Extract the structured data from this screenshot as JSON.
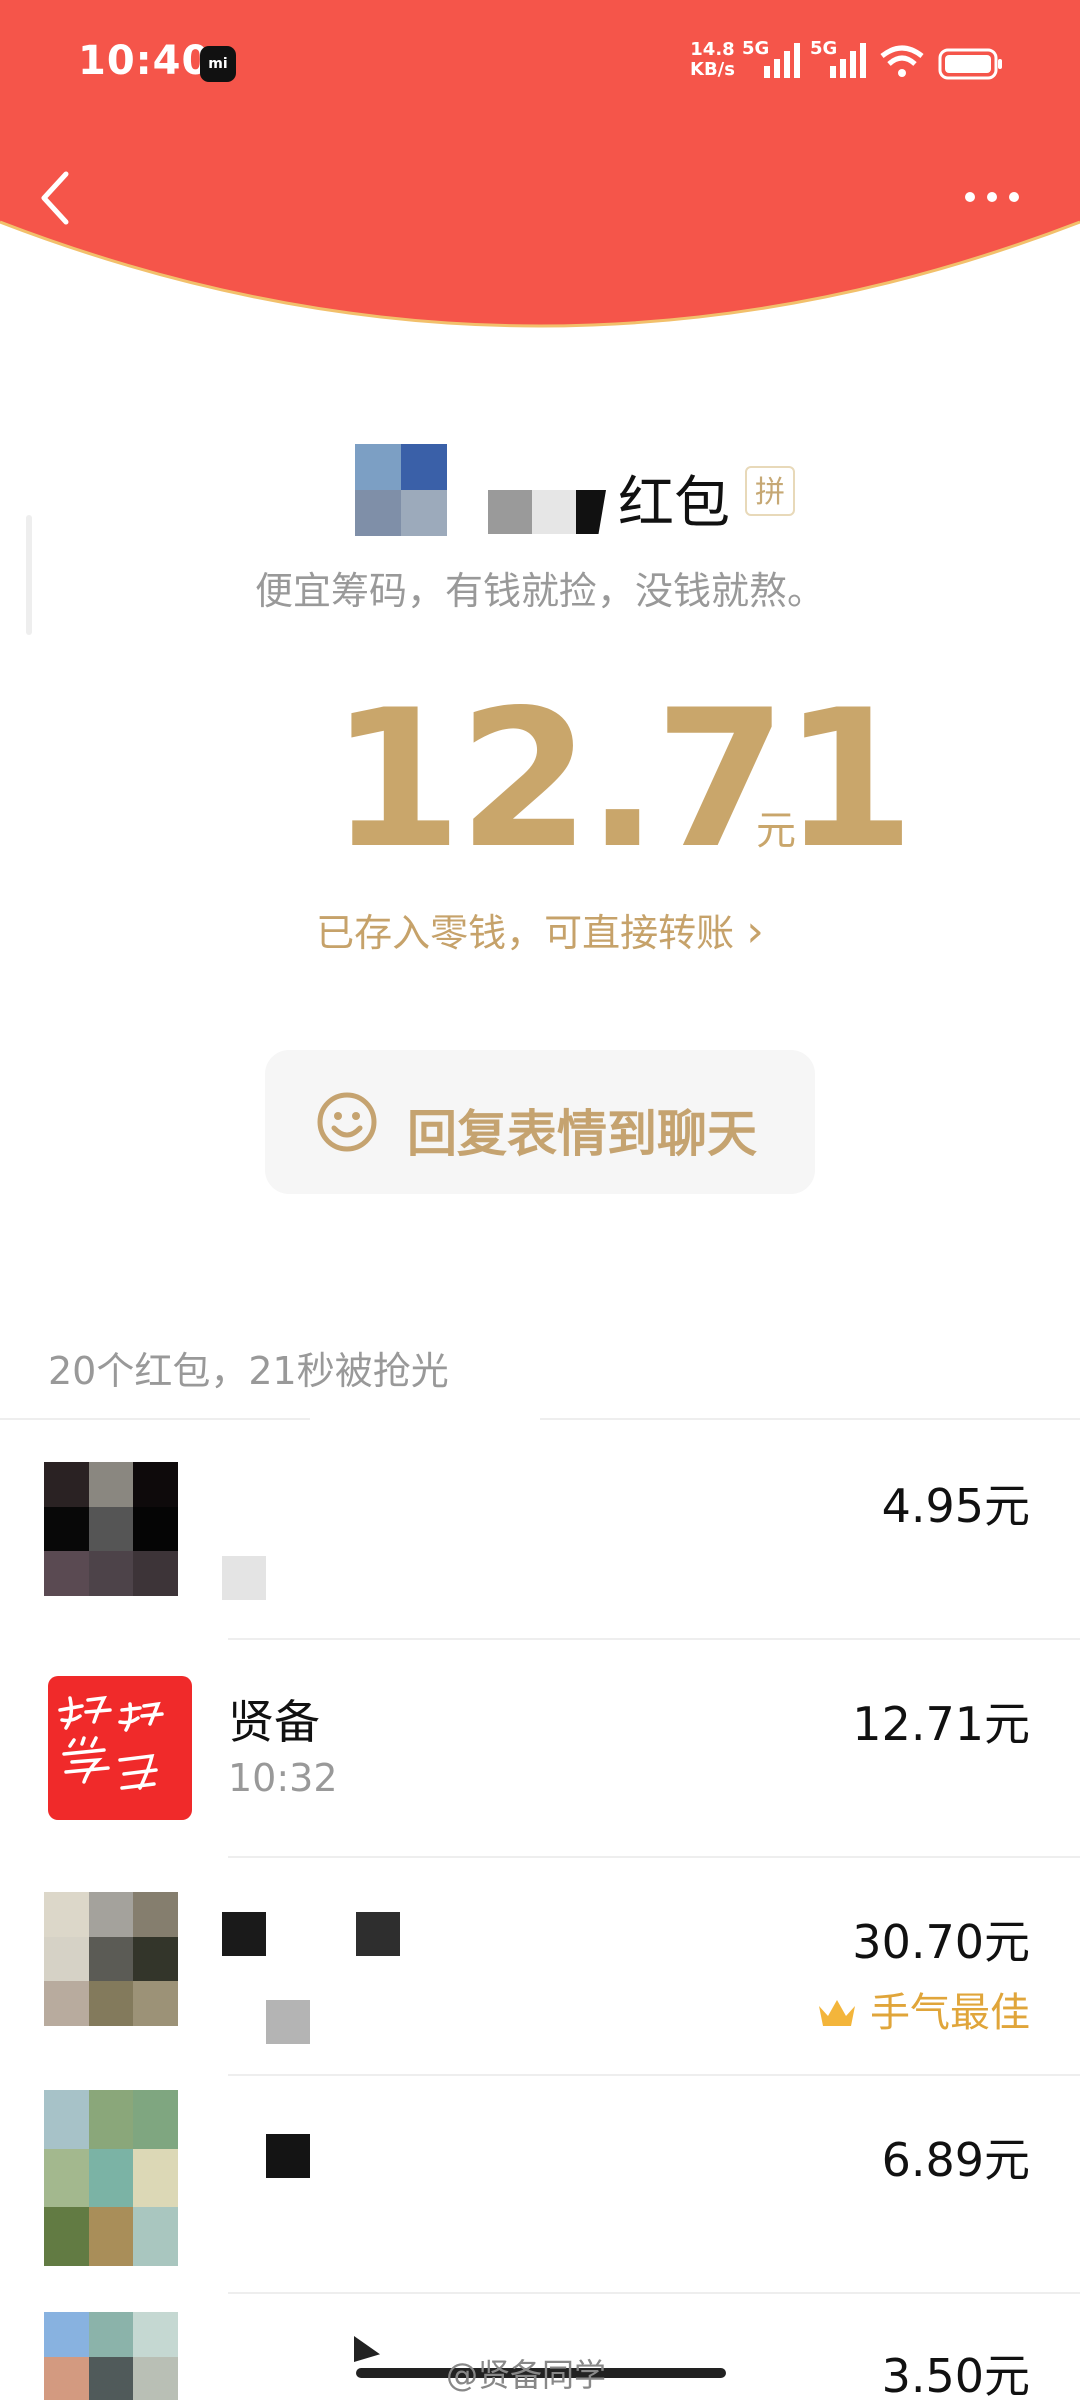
{
  "status_bar": {
    "time": "10:40",
    "mi_badge": "mi",
    "net_speed_value": "14.8",
    "net_speed_unit": "KB/s",
    "sim1": "5G",
    "sim2": "5G"
  },
  "colors": {
    "header_red": "#F5554A",
    "gold": "#C9A66B",
    "best_luck": "#E0A53A"
  },
  "header": {
    "back_icon": "chevron-left-icon",
    "more_icon": "more-dots-icon"
  },
  "sender": {
    "title": "红包",
    "badge": "拼",
    "blessing": "便宜筹码，有钱就捡，没钱就熬。"
  },
  "received": {
    "amount": "12.71",
    "unit": "元",
    "note": "已存入零钱，可直接转账",
    "note_chevron": "›"
  },
  "reply_button": {
    "icon": "smile-icon",
    "label": "回复表情到聊天"
  },
  "summary": "20个红包，21秒被抢光",
  "list": [
    {
      "name": "",
      "time": "",
      "amount": "4.95元",
      "best": ""
    },
    {
      "name": "贤备",
      "time": "10:32",
      "amount": "12.71元",
      "best": ""
    },
    {
      "name": "",
      "time": "",
      "amount": "30.70元",
      "best": "手气最佳"
    },
    {
      "name": "",
      "time": "",
      "amount": "6.89元",
      "best": ""
    },
    {
      "name": "",
      "time": "",
      "amount": "3.50元",
      "best": ""
    }
  ],
  "avatar_handwriting": "好好学习",
  "watermark": "@贤备同学"
}
